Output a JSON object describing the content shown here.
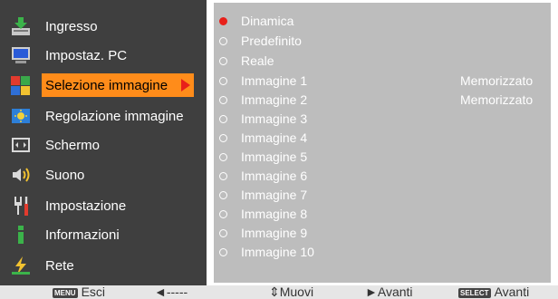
{
  "sidebar": {
    "items": [
      {
        "label": "Ingresso",
        "icon": "input-icon"
      },
      {
        "label": "Impostaz. PC",
        "icon": "pc-monitor-icon"
      },
      {
        "label": "Selezione immagine",
        "icon": "image-select-icon"
      },
      {
        "label": "Regolazione immagine",
        "icon": "image-adjust-icon"
      },
      {
        "label": "Schermo",
        "icon": "screen-icon"
      },
      {
        "label": "Suono",
        "icon": "speaker-icon"
      },
      {
        "label": "Impostazione",
        "icon": "settings-tools-icon"
      },
      {
        "label": "Informazioni",
        "icon": "info-icon"
      },
      {
        "label": "Rete",
        "icon": "network-icon"
      }
    ],
    "selected_index": 2
  },
  "options": {
    "items": [
      {
        "name": "Dinamica",
        "status": ""
      },
      {
        "name": "Predefinito",
        "status": ""
      },
      {
        "name": "Reale",
        "status": ""
      },
      {
        "name": "Immagine 1",
        "status": "Memorizzato"
      },
      {
        "name": "Immagine 2",
        "status": "Memorizzato"
      },
      {
        "name": "Immagine 3",
        "status": ""
      },
      {
        "name": "Immagine 4",
        "status": ""
      },
      {
        "name": "Immagine 5",
        "status": ""
      },
      {
        "name": "Immagine 6",
        "status": ""
      },
      {
        "name": "Immagine 7",
        "status": ""
      },
      {
        "name": "Immagine 8",
        "status": ""
      },
      {
        "name": "Immagine 9",
        "status": ""
      },
      {
        "name": "Immagine 10",
        "status": ""
      }
    ],
    "active_index": 0
  },
  "status_bar": {
    "menu_key": "MENU",
    "exit_label": "Esci",
    "back_label": "◄-----",
    "move_label": "⇕Muovi",
    "next_label": "►Avanti",
    "select_key": "SELECT",
    "select_label": "Avanti"
  },
  "colors": {
    "left_panel": "#3f3f3f",
    "right_panel": "#bdbdbd",
    "highlight": "#ff8c1a",
    "accent_red": "#e8201a",
    "status_bar": "#e6e6e6"
  }
}
